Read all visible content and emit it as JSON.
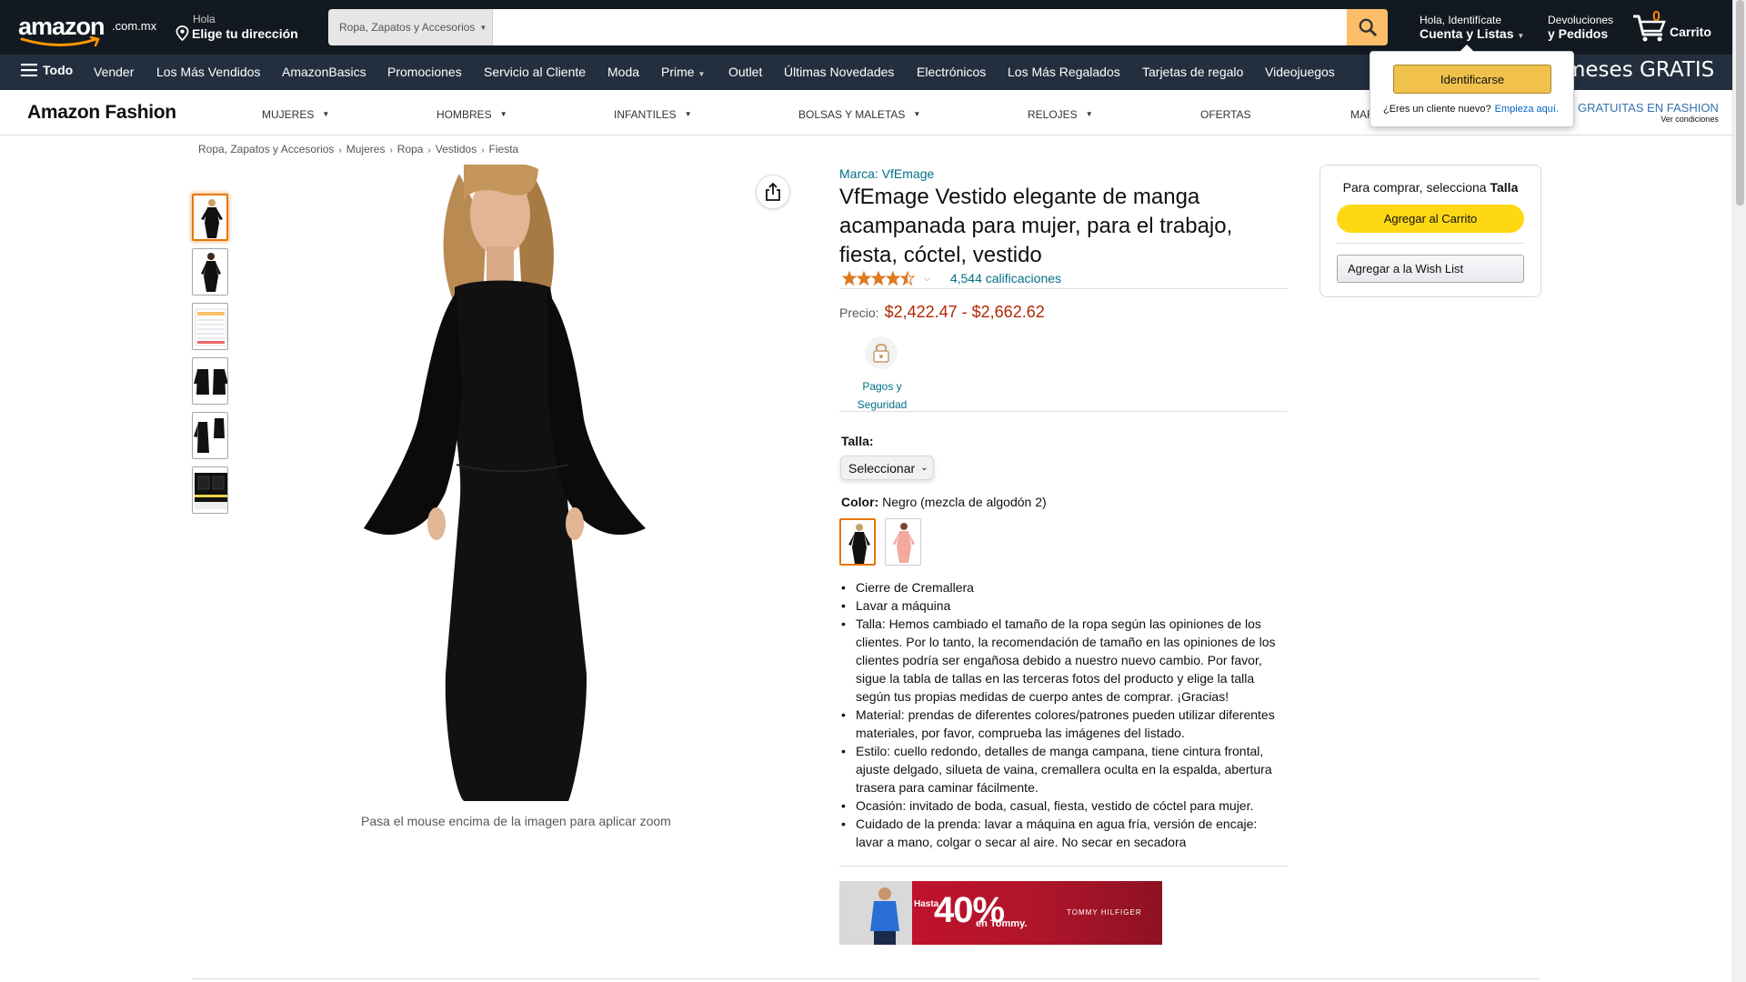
{
  "header": {
    "logo_word": "amazon",
    "logo_tld": ".com.mx",
    "address_line1": "Hola",
    "address_line2": "Elige tu dirección",
    "search_category": "Ropa, Zapatos y Accesorios",
    "search_value": "",
    "account_line1": "Hola, Identifícate",
    "account_line2": "Cuenta y Listas",
    "orders_line1": "Devoluciones",
    "orders_line2": "y Pedidos",
    "cart_count": "0",
    "cart_label": "Carrito"
  },
  "subnav": {
    "all_label": "Todo",
    "items": [
      "Vender",
      "Los Más Vendidos",
      "AmazonBasics",
      "Promociones",
      "Servicio al Cliente",
      "Moda",
      "Prime",
      "Outlet",
      "Últimas Novedades",
      "Electrónicos",
      "Los Más Regalados",
      "Tarjetas de regalo",
      "Videojuegos"
    ],
    "promo": "meses GRATIS"
  },
  "fashion": {
    "logo": "Amazon Fashion",
    "categories": [
      "MUJERES",
      "HOMBRES",
      "INFANTILES",
      "BOLSAS Y MALETAS",
      "RELOJES",
      "OFERTAS",
      "MAR"
    ],
    "promo_line1": "GRATUITAS EN FASHION",
    "promo_line2": "Ver condiciones"
  },
  "flyout": {
    "signin_label": "Identificarse",
    "new_customer": "¿Eres un cliente nuevo?",
    "start_here": "Empieza aquí."
  },
  "breadcrumb": [
    "Ropa, Zapatos y Accesorios",
    "Mujeres",
    "Ropa",
    "Vestidos",
    "Fiesta"
  ],
  "gallery": {
    "thumbnail_count": 6,
    "selected_index": 0,
    "zoom_hint": "Pasa el mouse encima de la imagen para aplicar zoom"
  },
  "product": {
    "brand": "Marca: VfEmage",
    "title": "VfEmage Vestido elegante de manga acampanada para mujer, para el trabajo, fiesta, cóctel, vestido",
    "stars": 4.5,
    "ratings": "4,544 calificaciones",
    "price_label": "Precio:",
    "price": "$2,422.47 - $2,662.62",
    "payment_label": "Pagos y Seguridad",
    "size_label": "Talla:",
    "size_value": "Seleccionar",
    "color_label": "Color:",
    "color_value": "Negro (mezcla de algodón 2)",
    "bullets": [
      "Cierre de Cremallera",
      "Lavar a máquina",
      "Talla: Hemos cambiado el tamaño de la ropa según las opiniones de los clientes. Por lo tanto, la recomendación de tamaño en las opiniones de los clientes podría ser engañosa debido a nuestro nuevo cambio. Por favor, sigue la tabla de tallas en las terceras fotos del producto y elige la talla según tus propias medidas de cuerpo antes de comprar. ¡Gracias!",
      "Material: prendas de diferentes colores/patrones pueden utilizar diferentes materiales, por favor, comprueba las imágenes del listado.",
      "Estilo: cuello redondo, detalles de manga campana, tiene cintura frontal, ajuste delgado, silueta de vaina, cremallera oculta en la espalda, abertura trasera para caminar fácilmente.",
      "Ocasión: invitado de boda, casual, fiesta, vestido de cóctel para mujer.",
      "Cuidado de la prenda: lavar a máquina en agua fría, versión de encaje: lavar a mano, colgar o secar al aire. No secar en secadora"
    ]
  },
  "banner": {
    "hasta": "Hasta",
    "percent": "40%",
    "suffix": "en Tommy.",
    "brand": "TOMMY HILFIGER"
  },
  "buybox": {
    "prompt": "Para comprar, selecciona",
    "prompt_bold": "Talla",
    "add_to_cart": "Agregar al Carrito",
    "wishlist": "Agregar a la Wish List"
  },
  "colors": {
    "nav_dark": "#131921",
    "nav_sub": "#232f3e",
    "search_button": "#febd69",
    "link": "#007185",
    "price": "#b12704",
    "cart_button": "#ffd814",
    "selected_outline": "#e77600"
  }
}
